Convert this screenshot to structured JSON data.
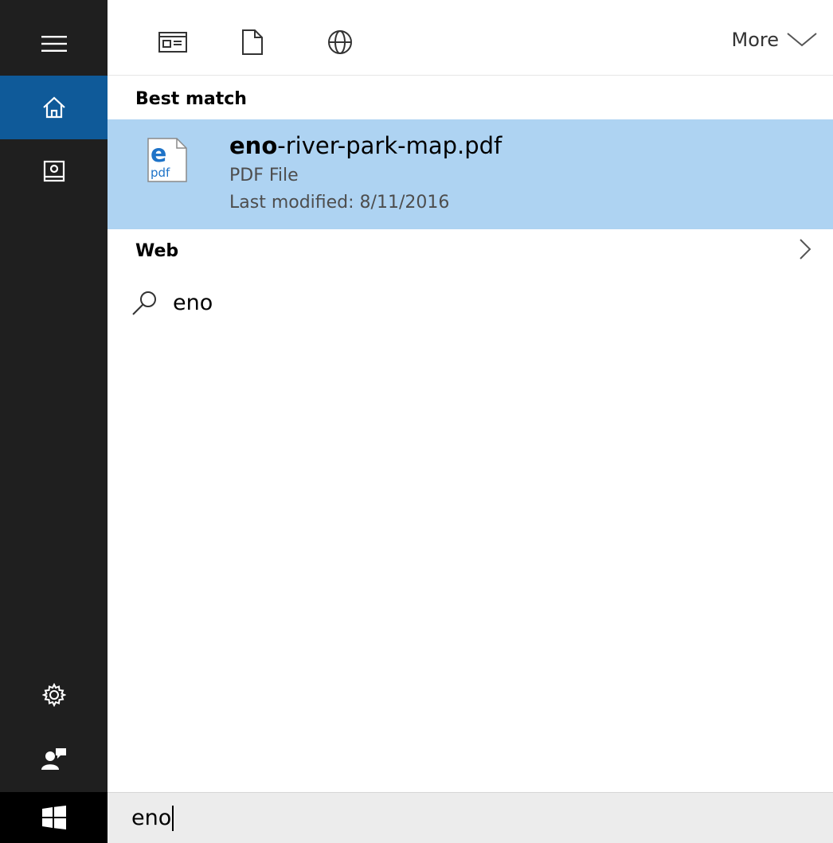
{
  "colors": {
    "rail_bg": "#1f1f1f",
    "rail_active": "#0f5a99",
    "selection": "#aed3f2",
    "searchbox_bg": "#ececec"
  },
  "rail": {
    "items": [
      {
        "icon": "hamburger-menu-icon"
      },
      {
        "icon": "home-icon",
        "active": true
      },
      {
        "icon": "notebook-icon"
      },
      {
        "icon": "settings-gear-icon"
      },
      {
        "icon": "feedback-person-icon"
      },
      {
        "icon": "windows-start-icon"
      }
    ]
  },
  "toolbar": {
    "filters": [
      {
        "icon": "apps-filter-icon"
      },
      {
        "icon": "documents-filter-icon"
      },
      {
        "icon": "web-globe-icon"
      }
    ],
    "more_label": "More"
  },
  "best_match": {
    "section_title": "Best match",
    "item": {
      "name_highlight": "eno",
      "name_rest": "-river-park-map.pdf",
      "type": "PDF File",
      "modified": "Last modified: 8/11/2016",
      "icon_letter": "e",
      "icon_label": "pdf"
    }
  },
  "web": {
    "section_title": "Web",
    "items": [
      {
        "text": "eno"
      }
    ]
  },
  "search": {
    "value": "eno"
  }
}
